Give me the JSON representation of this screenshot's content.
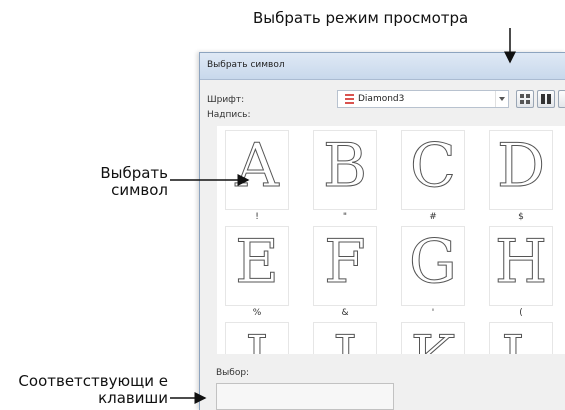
{
  "callouts": {
    "view_mode": "Выбрать режим просмотра",
    "select_symbol": "Выбрать символ",
    "matching_keys": "Соответствующи е клавиши"
  },
  "dialog": {
    "title": "Выбрать символ",
    "font_label": "Шрифт:",
    "font_value": "Diamond3",
    "caption_label": "Надпись:",
    "selection_label": "Выбор:",
    "selection_value": ""
  },
  "symbols": [
    {
      "glyph": "A",
      "key": "!"
    },
    {
      "glyph": "B",
      "key": "\""
    },
    {
      "glyph": "C",
      "key": "#"
    },
    {
      "glyph": "D",
      "key": "$"
    },
    {
      "glyph": "E",
      "key": "%"
    },
    {
      "glyph": "F",
      "key": "&"
    },
    {
      "glyph": "G",
      "key": "'"
    },
    {
      "glyph": "H",
      "key": "("
    },
    {
      "glyph": "I",
      "key": ""
    },
    {
      "glyph": "J",
      "key": ""
    },
    {
      "glyph": "K",
      "key": ""
    },
    {
      "glyph": "L",
      "key": ""
    }
  ],
  "colors": {
    "titlebar": "#c8d8ec",
    "font_icon": "#d9534f"
  }
}
